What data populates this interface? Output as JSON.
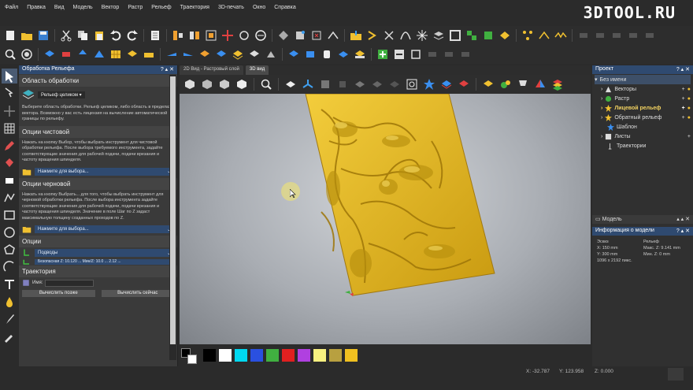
{
  "menu": [
    "Файл",
    "Правка",
    "Вид",
    "Модель",
    "Вектор",
    "Растр",
    "Рельеф",
    "Траектория",
    "3D-печать",
    "Окно",
    "Справка"
  ],
  "brand": "3DTOOL.RU",
  "left_panel": {
    "title": "Обработка Рельефа",
    "area_section": "Область обработки",
    "area_select": "Рельеф целиком",
    "area_text": "Выберите область обработки. Рельеф целиком, либо область в пределах вектора. Возможно у вас есть лицензия на вычисление автоматической границы по рельефу.",
    "finish_section": "Опции чистовой",
    "finish_text": "Нажать на кнопку Выбор, чтобы выбрать инструмент для чистовой обработки рельефа. После выбора требуемого инструмента, задайте соответствующие значения для рабочей подачи, подачи врезания и частоту вращения шпинделя.",
    "finish_dd": "Нажмите для выбора...",
    "rough_section": "Опции черновой",
    "rough_text": "Нажать на кнопку Выбрать... для того, чтобы выбрать инструмент для черновой обработки рельефа. После выбора инструмента задайте соответствующие значения для рабочей подачи, подачи врезания и частоту вращения шпинделя. Значение в поле Шаг по Z задаст максимальную толщину созданных проходов по Z.",
    "rough_dd": "Нажмите для выбора...",
    "options_section": "Опции",
    "options_dd": "Подводы",
    "options_extra": "Безопасная Z: 10.120 ... Мин/Z: 10.0 ... 2.12 ...",
    "traj_section": "Траектория",
    "name_label": "Имя:",
    "btn_later": "Вычислить позже",
    "btn_now": "Вычислить сейчас"
  },
  "tabs": [
    "2D Вид - Растровый слой",
    "3D вид"
  ],
  "project": {
    "title": "Проект",
    "items": [
      {
        "label": "Без имени",
        "type": "root"
      },
      {
        "label": "Векторы",
        "type": "item"
      },
      {
        "label": "Растр",
        "type": "item"
      },
      {
        "label": "Лицевой рельеф",
        "type": "highlight"
      },
      {
        "label": "Обратный рельеф",
        "type": "item"
      },
      {
        "label": "Шаблон",
        "type": "item"
      },
      {
        "label": "Листы",
        "type": "item"
      },
      {
        "label": "Траектории",
        "type": "item"
      }
    ]
  },
  "model": {
    "head": "Модель",
    "info_title": "Информация о модели",
    "sketch_label": "Эскиз",
    "relief_label": "Рельеф",
    "x": "X: 150 mm",
    "maxz": "Макс. Z: 9.141 mm",
    "y": "Y: 300 mm",
    "minz": "Мин. Z: 0 mm",
    "pixels": "1096 x 2192 пикс."
  },
  "status": {
    "x": "X: -32.787",
    "y": "Y: 123.958",
    "z": "Z: 0.000"
  },
  "colors": {
    "relief": "#e0b520",
    "accent": "#2f4a70",
    "palette": [
      "#000000",
      "#ffffff",
      "#00d8f0",
      "#2a50e0",
      "#40b040",
      "#e02020",
      "#b040e0",
      "#f8f080",
      "#b8a040",
      "#f0c020"
    ]
  }
}
